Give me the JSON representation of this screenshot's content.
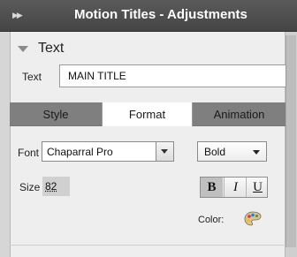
{
  "panel": {
    "title": "Motion Titles - Adjustments"
  },
  "section": {
    "label": "Text"
  },
  "text_field": {
    "label": "Text",
    "value": "MAIN TITLE"
  },
  "tabs": [
    {
      "label": "Style",
      "active": false
    },
    {
      "label": "Format",
      "active": true
    },
    {
      "label": "Animation",
      "active": false
    }
  ],
  "format": {
    "font_label": "Font",
    "font_value": "Chaparral Pro",
    "font_style_value": "Bold",
    "size_label": "Size",
    "size_value": "82",
    "bold_label": "B",
    "italic_label": "I",
    "underline_label": "U",
    "bold_active": true,
    "color_label": "Color:"
  },
  "icons": {
    "collapse": "double-chevron-right-icon",
    "section_toggle": "triangle-down-icon",
    "dropdown": "chevron-down-icon",
    "color_picker": "palette-icon"
  }
}
